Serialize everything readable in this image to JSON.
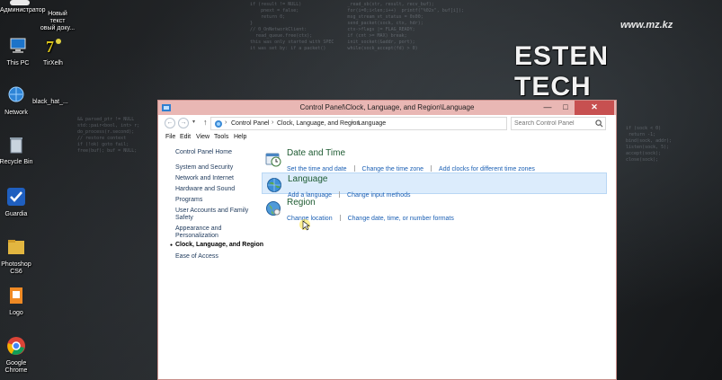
{
  "desktop": {
    "watermark": {
      "logo": "ESTEN TECH",
      "url": "www.mz.kz"
    },
    "icons": [
      {
        "label_lines": [
          "Администратор",
          "Новый текст",
          "овый доку..."
        ],
        "name": "admin-doc-icon"
      },
      {
        "label_lines": [
          "This PC"
        ],
        "name": "this-pc-icon"
      },
      {
        "label_lines": [
          "TirXelh"
        ],
        "name": "tirxelh-icon"
      },
      {
        "label_lines": [
          "Network"
        ],
        "name": "network-icon"
      },
      {
        "label_lines": [
          "black_hat_..."
        ],
        "name": "black-hat-folder-icon"
      },
      {
        "label_lines": [
          "Recycle Bin"
        ],
        "name": "recycle-bin-icon"
      },
      {
        "label_lines": [
          "Guardia"
        ],
        "name": "guardia-icon"
      },
      {
        "label_lines": [
          "Photoshop",
          "CS6"
        ],
        "name": "photoshop-icon"
      },
      {
        "label_lines": [
          "Logo"
        ],
        "name": "logo-file-icon"
      },
      {
        "label_lines": [
          "Google",
          "Chrome"
        ],
        "name": "chrome-icon"
      }
    ]
  },
  "window": {
    "title": "Control Panel\\Clock, Language, and Region\\Language",
    "controls": {
      "minimize": "—",
      "maximize": "□",
      "close": "✕"
    },
    "address": {
      "crumbs": [
        "Control Panel",
        "Clock, Language, and Region",
        "Language"
      ],
      "separator": "›"
    },
    "search": {
      "placeholder": "Search Control Panel"
    },
    "menu": [
      "File",
      "Edit",
      "View",
      "Tools",
      "Help"
    ],
    "sidebar": {
      "home": "Control Panel Home",
      "items": [
        {
          "label": "System and Security",
          "active": false
        },
        {
          "label": "Network and Internet",
          "active": false
        },
        {
          "label": "Hardware and Sound",
          "active": false
        },
        {
          "label": "Programs",
          "active": false
        },
        {
          "label": "User Accounts and Family",
          "label2": "Safety",
          "active": false
        },
        {
          "label": "Appearance and",
          "label2": "Personalization",
          "active": false
        },
        {
          "label": "Clock, Language, and Region",
          "active": true
        },
        {
          "label": "Ease of Access",
          "active": false
        }
      ]
    },
    "categories": [
      {
        "title": "Date and Time",
        "links": [
          "Set the time and date",
          "Change the time zone",
          "Add clocks for different time zones"
        ]
      },
      {
        "title": "Language",
        "links": [
          "Add a language",
          "Change input methods"
        ]
      },
      {
        "title": "Region",
        "links": [
          "Change location",
          "Change date, time, or number formats"
        ]
      }
    ]
  },
  "colors": {
    "titlebar": "#e9b7b4",
    "close_button": "#c75050",
    "link": "#1a5fb4",
    "category_title": "#1e5b32",
    "selected_row": "#dcecfc"
  }
}
